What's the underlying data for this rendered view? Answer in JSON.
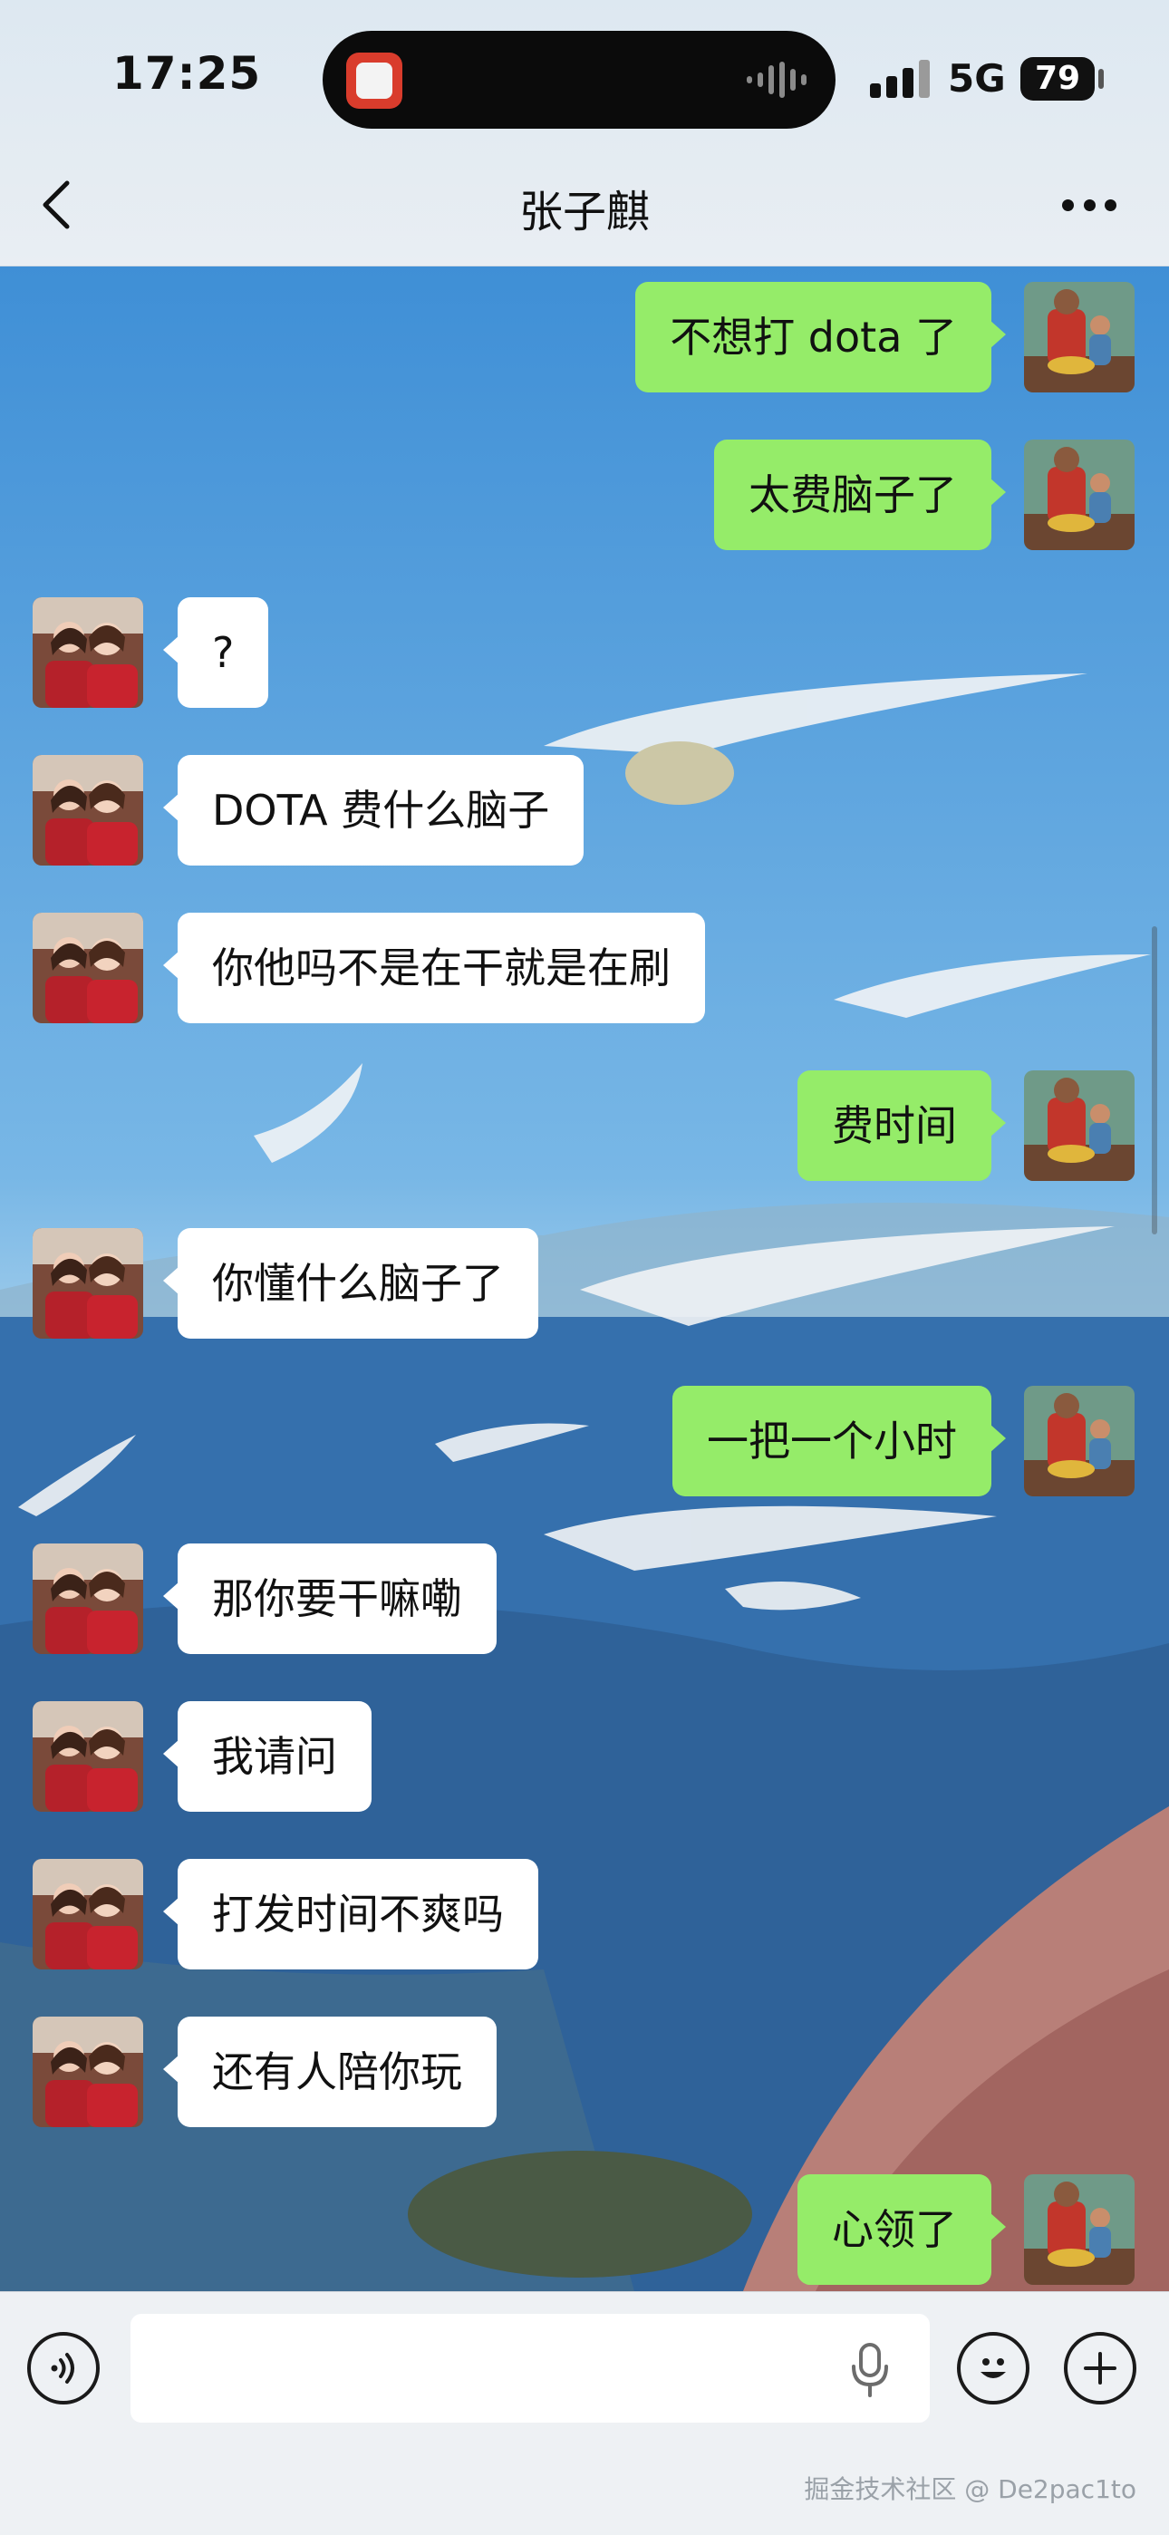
{
  "status_bar": {
    "time": "17:25",
    "network": "5G",
    "battery": "79"
  },
  "header": {
    "title": "张子麒",
    "back_icon": "chevron-left-icon",
    "more_icon": "ellipsis-icon"
  },
  "messages": [
    {
      "side": "right",
      "text": "不想打 dota 了"
    },
    {
      "side": "right",
      "text": "太费脑子了"
    },
    {
      "side": "left",
      "text": "?"
    },
    {
      "side": "left",
      "text": "DOTA 费什么脑子"
    },
    {
      "side": "left",
      "text": "你他吗不是在干就是在刷"
    },
    {
      "side": "right",
      "text": "费时间"
    },
    {
      "side": "left",
      "text": "你懂什么脑子了"
    },
    {
      "side": "right",
      "text": "一把一个小时"
    },
    {
      "side": "left",
      "text": "那你要干嘛嘞"
    },
    {
      "side": "left",
      "text": "我请问"
    },
    {
      "side": "left",
      "text": "打发时间不爽吗"
    },
    {
      "side": "left",
      "text": "还有人陪你玩"
    },
    {
      "side": "right",
      "text": "心领了"
    }
  ],
  "input_bar": {
    "voice_icon": "voice-icon",
    "mic_icon": "microphone-icon",
    "emoji_icon": "emoji-icon",
    "plus_icon": "plus-icon",
    "text_value": "",
    "placeholder": ""
  },
  "watermark": "掘金技术社区 @ De2pac1to",
  "colors": {
    "sent_bubble": "#95ec69",
    "received_bubble": "#ffffff"
  }
}
